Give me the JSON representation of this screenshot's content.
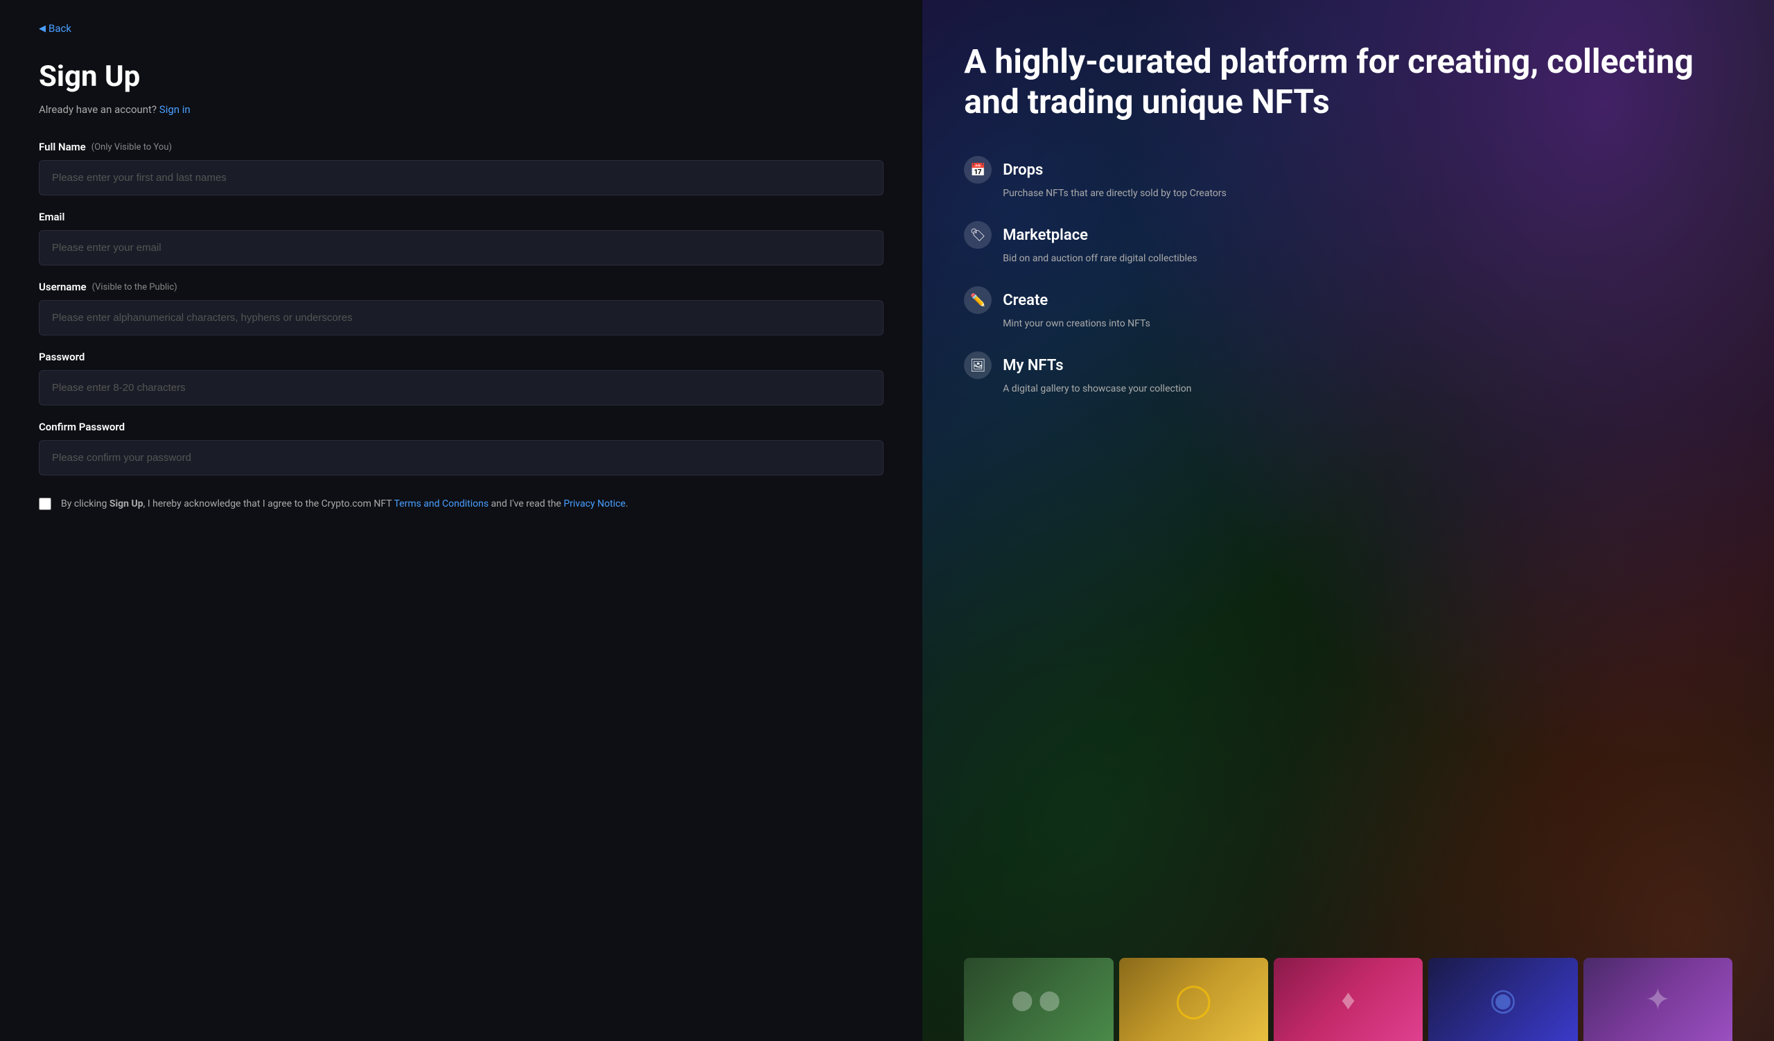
{
  "left": {
    "back_label": "Back",
    "title": "Sign Up",
    "account_text": "Already have an account?",
    "signin_label": "Sign in",
    "fields": {
      "fullname": {
        "label": "Full Name",
        "note": "(Only Visible to You)",
        "placeholder": "Please enter your first and last names"
      },
      "email": {
        "label": "Email",
        "note": "",
        "placeholder": "Please enter your email"
      },
      "username": {
        "label": "Username",
        "note": "(Visible to the Public)",
        "placeholder": "Please enter alphanumerical characters, hyphens or underscores"
      },
      "password": {
        "label": "Password",
        "note": "",
        "placeholder": "Please enter 8-20 characters"
      },
      "confirm_password": {
        "label": "Confirm Password",
        "note": "",
        "placeholder": "Please confirm your password"
      }
    },
    "terms": {
      "prefix": "By clicking ",
      "bold": "Sign Up",
      "middle": ", I hereby acknowledge that I agree to the Crypto.com NFT ",
      "link1": "Terms and Conditions",
      "and_text": " and I've read the ",
      "link2": "Privacy Notice",
      "suffix": "."
    }
  },
  "right": {
    "hero_title": "A highly-curated platform for creating, collecting and trading unique NFTs",
    "features": [
      {
        "icon": "📅",
        "name": "Drops",
        "description": "Purchase NFTs that are directly sold by top Creators"
      },
      {
        "icon": "🏷",
        "name": "Marketplace",
        "description": "Bid on and auction off rare digital collectibles"
      },
      {
        "icon": "✏️",
        "name": "Create",
        "description": "Mint your own creations into NFTs"
      },
      {
        "icon": "🖼",
        "name": "My NFTs",
        "description": "A digital gallery to showcase your collection"
      }
    ]
  },
  "colors": {
    "accent": "#4a9eff",
    "bg_left": "#0d0f14",
    "input_bg": "#1a1d27",
    "input_border": "#2a2d3a"
  }
}
